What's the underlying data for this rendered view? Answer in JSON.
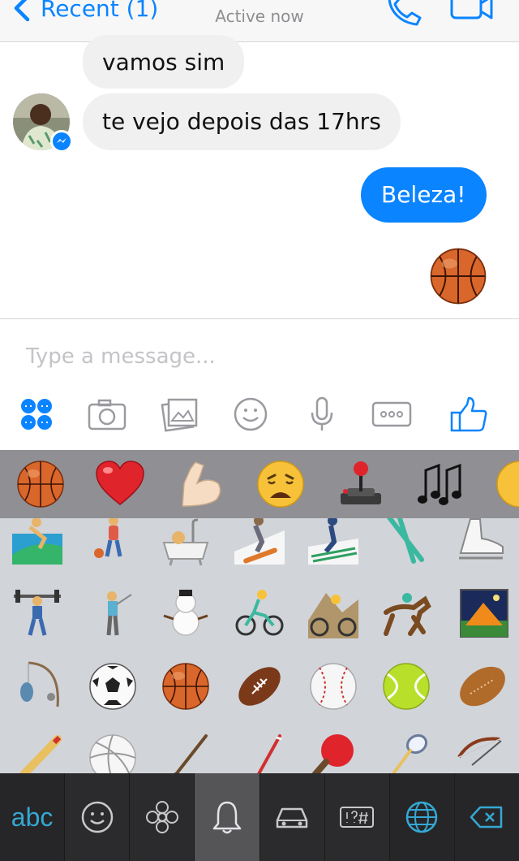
{
  "nav": {
    "back_label": "Recent (1)",
    "status": "Active now"
  },
  "chat": {
    "incoming": [
      "vamos sim",
      "te vejo depois das 17hrs"
    ],
    "outgoing": [
      "Beleza!"
    ],
    "sent_emoji": "basketball-emoji"
  },
  "composer": {
    "placeholder": "Type a message...",
    "tools": [
      "apps-icon",
      "camera-icon",
      "gallery-icon",
      "smiley-icon",
      "microphone-icon",
      "more-icon",
      "thumbs-up-icon"
    ]
  },
  "emoji_recents": [
    "basketball",
    "red-heart",
    "flexed-biceps",
    "weary-face",
    "joystick",
    "musical-notes",
    "smirking-face"
  ],
  "emoji_grid": [
    [
      "surfer",
      "person-bouncing-ball",
      "bathtub",
      "snowboarder",
      "skier",
      "skis",
      "ice-skate"
    ],
    [
      "weight-lifter",
      "golfer",
      "snowman",
      "bicyclist",
      "mountain-bicyclist",
      "horse-racing",
      "camping-tent"
    ],
    [
      "fishing-pole",
      "soccer-ball",
      "basketball",
      "american-football",
      "baseball",
      "tennis",
      "rugby-football"
    ],
    [
      "cricket",
      "volleyball",
      "hockey-stick",
      "field-hockey",
      "ping-pong",
      "badminton",
      "bow-and-arrow"
    ]
  ],
  "keyboard": {
    "abc_label": "abc",
    "tabs": [
      "abc",
      "smiley-icon",
      "flower-icon",
      "bell-icon",
      "car-icon",
      "symbols-icon",
      "globe-icon",
      "backspace-icon"
    ],
    "active_tab": "bell-icon"
  },
  "colors": {
    "accent": "#0a84ff",
    "keyboard_accent": "#35a8d4",
    "bubble_in": "#f0f0f0"
  }
}
